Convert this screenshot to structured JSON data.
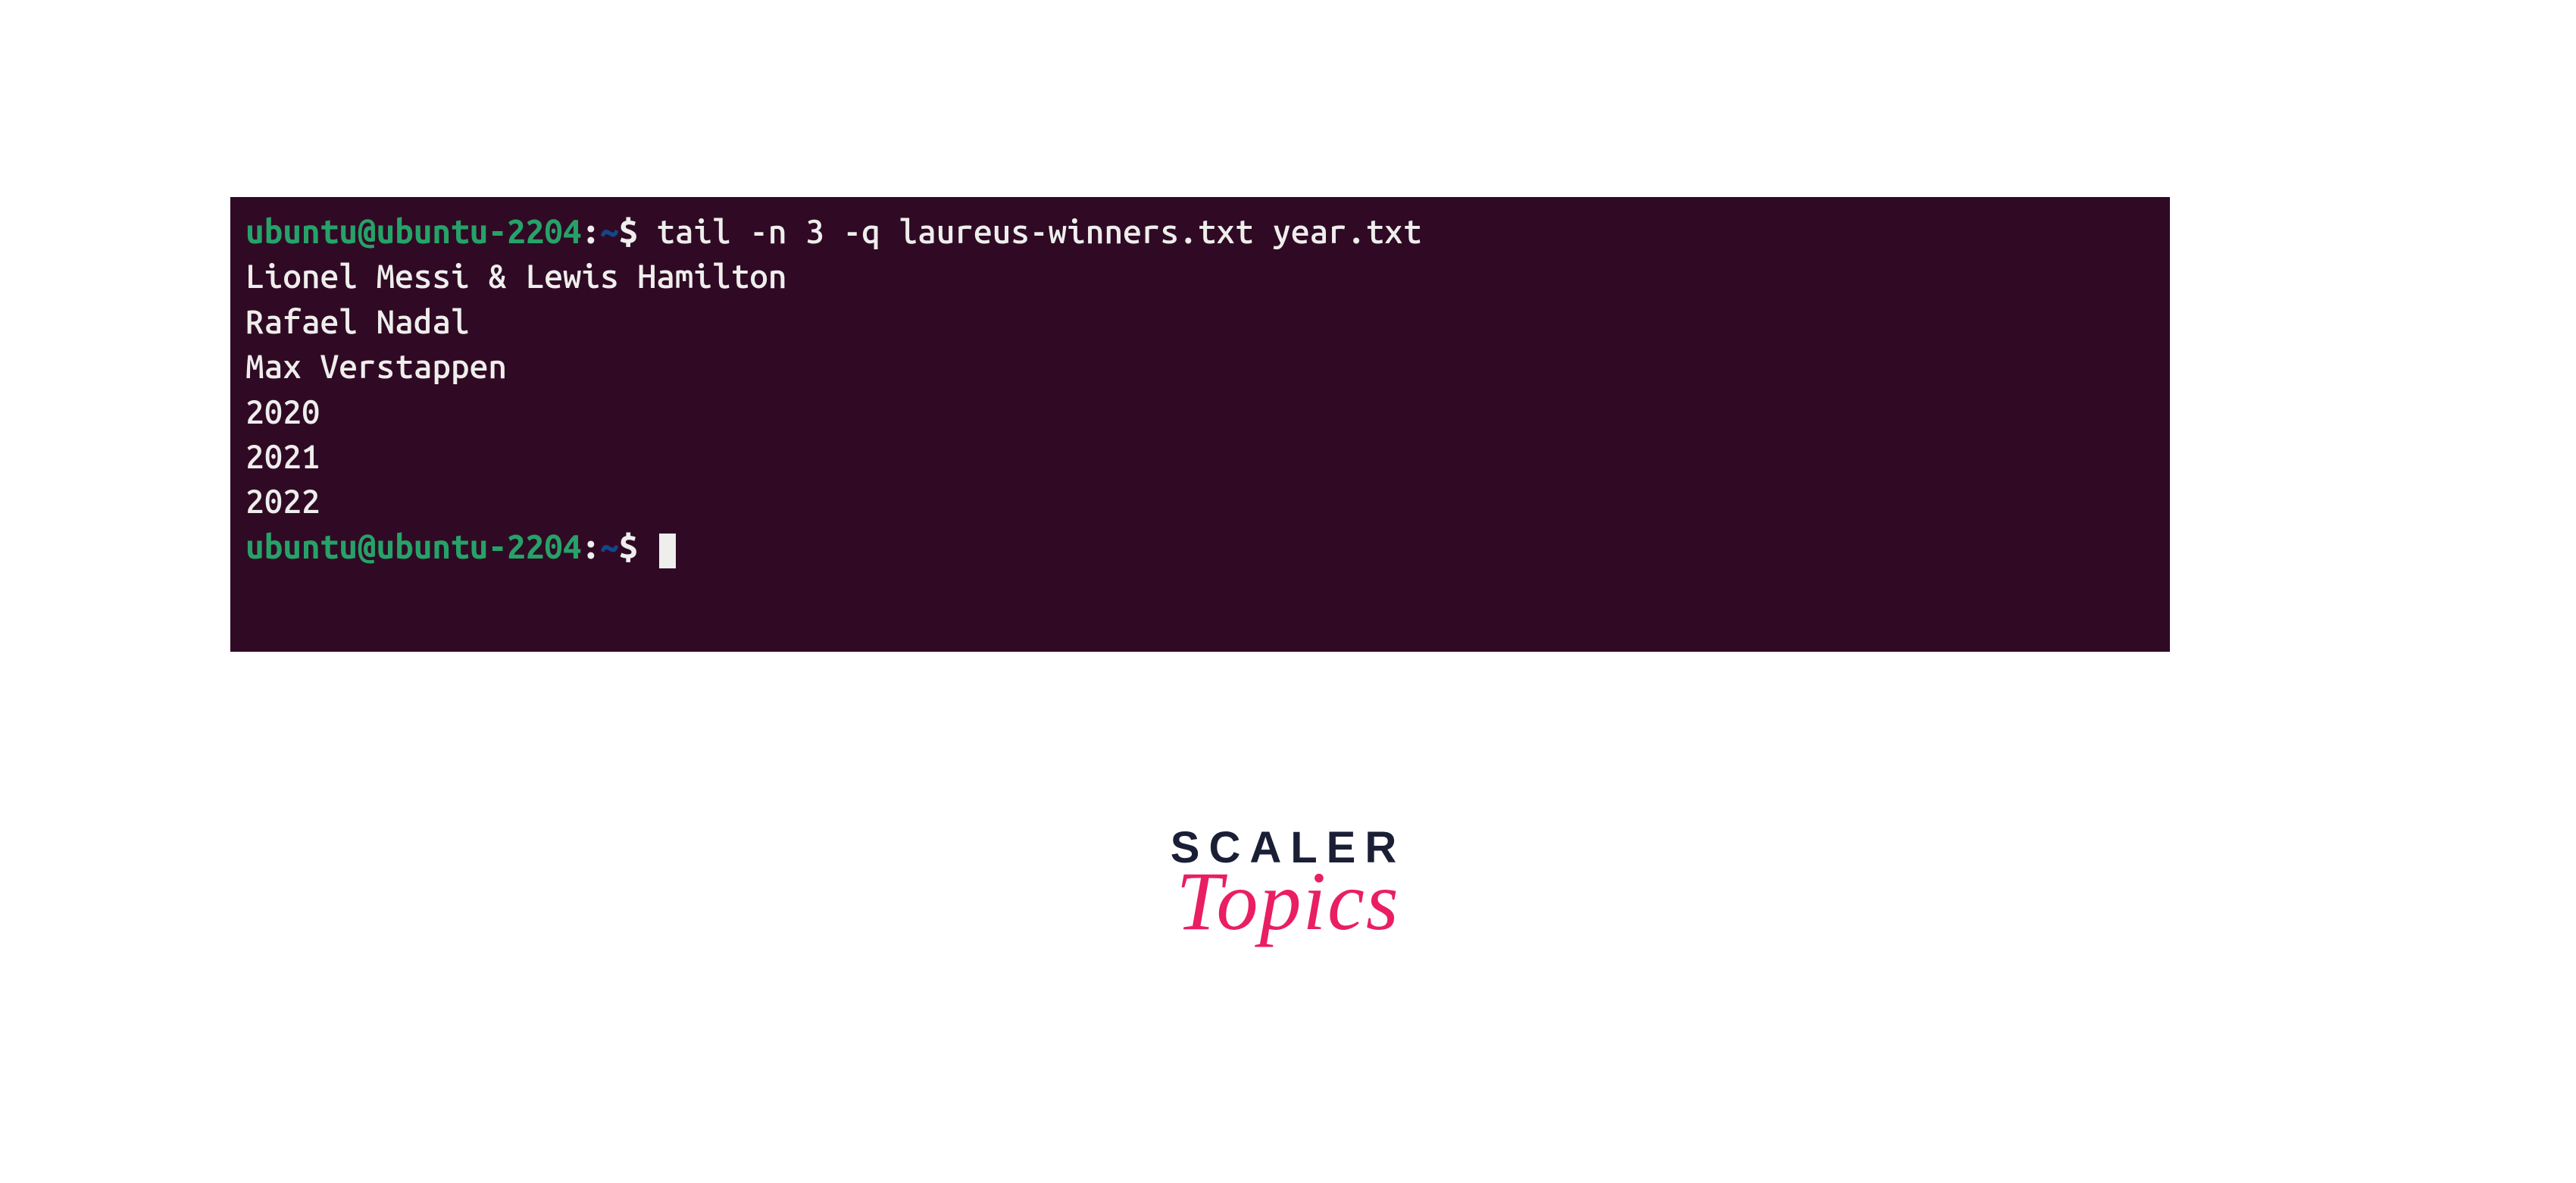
{
  "terminal": {
    "prompt1": {
      "user_host": "ubuntu@ubuntu-2204",
      "separator1": ":",
      "path": "~",
      "separator2": "$",
      "command": " tail -n 3 -q laureus-winners.txt year.txt"
    },
    "output_lines": [
      "Lionel Messi & Lewis Hamilton",
      "Rafael Nadal",
      "Max Verstappen",
      "2020",
      "2021",
      "2022"
    ],
    "prompt2": {
      "user_host": "ubuntu@ubuntu-2204",
      "separator1": ":",
      "path": "~",
      "separator2": "$",
      "command": " "
    }
  },
  "logo": {
    "line1": "SCALER",
    "line2": "Topics"
  }
}
